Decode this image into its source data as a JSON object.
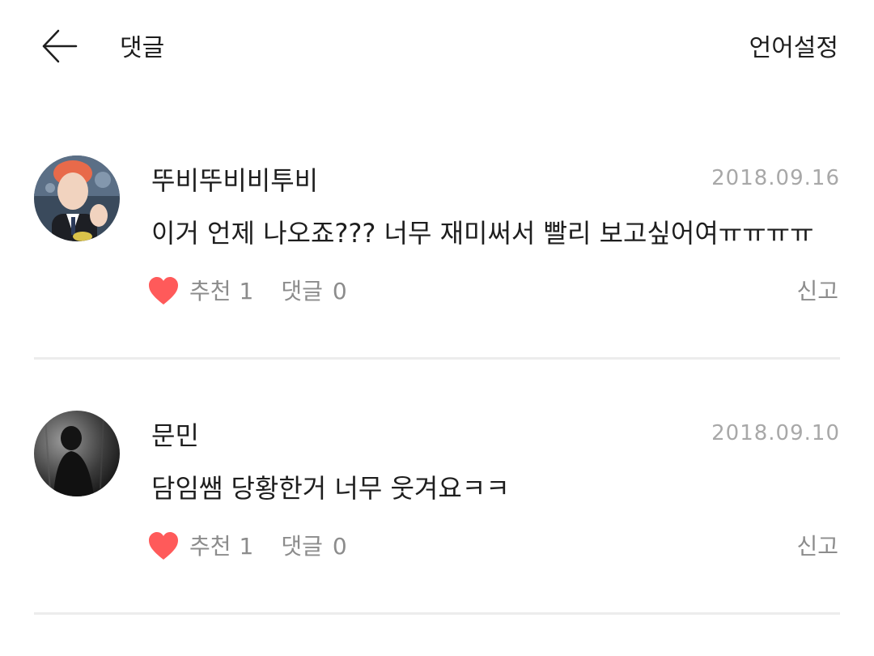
{
  "header": {
    "title": "댓글",
    "language_setting_label": "언어설정",
    "back_icon": "arrow-left-icon"
  },
  "comments": [
    {
      "author": "뚜비뚜비비투비",
      "date": "2018.09.16",
      "text": "이거 언제 나오죠??? 너무 재미써서 빨리 보고싶어여ㅠㅠㅠㅠ",
      "like_label": "추천",
      "like_count": "1",
      "reply_label": "댓글",
      "reply_count": "0",
      "report_label": "신고"
    },
    {
      "author": "문민",
      "date": "2018.09.10",
      "text": "담임쌤 당황한거 너무 웃겨요ㅋㅋ",
      "like_label": "추천",
      "like_count": "1",
      "reply_label": "댓글",
      "reply_count": "0",
      "report_label": "신고"
    }
  ],
  "colors": {
    "heart": "#ff5a5a",
    "meta_text": "#8c8c8c",
    "date_text": "#a8a8a8",
    "divider": "#ececec"
  }
}
